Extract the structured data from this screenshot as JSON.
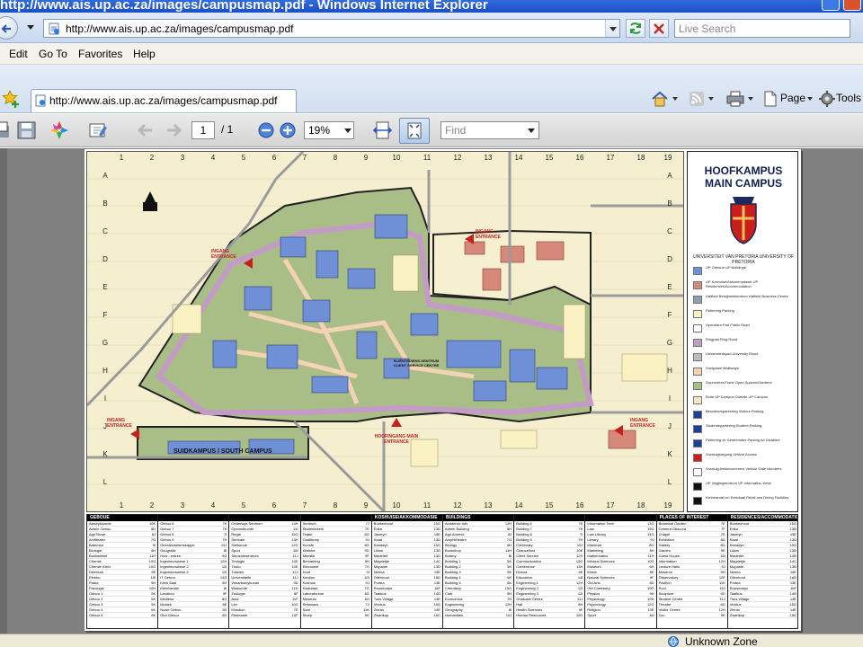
{
  "window": {
    "title": "http://www.ais.up.ac.za/images/campusmap.pdf - Windows Internet Explorer"
  },
  "address": {
    "url": "http://www.ais.up.ac.za/images/campusmap.pdf",
    "search_placeholder": "Live Search"
  },
  "menu": [
    "Edit",
    "Go To",
    "Favorites",
    "Help"
  ],
  "tab": {
    "label": "http://www.ais.up.ac.za/images/campusmap.pdf"
  },
  "command_bar": {
    "page_label": "Page",
    "tools_label": "Tools"
  },
  "pdf_toolbar": {
    "page_current": "1",
    "page_sep": "/ 1",
    "zoom": "19%",
    "find_placeholder": "Find"
  },
  "map": {
    "grid_columns": [
      "1",
      "2",
      "3",
      "4",
      "5",
      "6",
      "7",
      "8",
      "9",
      "10",
      "11",
      "12",
      "13",
      "14",
      "15",
      "16",
      "17",
      "18",
      "19"
    ],
    "grid_rows": [
      "A",
      "B",
      "C",
      "D",
      "E",
      "F",
      "G",
      "H",
      "I",
      "J",
      "K",
      "L"
    ],
    "labels": {
      "south_campus": "SUIDKAMPUS / SOUTH CAMPUS",
      "entrance_west": "INGANG ENTRANCE",
      "entrance_north": "INGANG ENTRANCE",
      "entrance_sw": "INGANG ENTRANCE",
      "entrance_east": "INGANG ENTRANCE",
      "main_entrance": "HOOFINGANG MAIN ENTRANCE",
      "client_service": "KLIËNTEDIENS-SENTRUM CLIENT SERVICE CENTRE"
    }
  },
  "legend": {
    "title_af": "HOOFKAMPUS",
    "title_en": "MAIN CAMPUS",
    "university": "UNIVERSITEIT VAN PRETORIA UNIVERSITY OF PRETORIA",
    "items": [
      {
        "label": "UP Geboue UP Buildings",
        "color": "#6f8fd6"
      },
      {
        "label": "UP Koshuise/Akkommodasie UP Residences/Accommodation",
        "color": "#d6897a"
      },
      {
        "label": "Hatfield Besigheidsentrum Hatfield Business Centre",
        "color": "#8ea0b0"
      },
      {
        "label": "Parkering Parking",
        "color": "#fbf2c4"
      },
      {
        "label": "Openbare Pad Public Road",
        "color": "#ffffff"
      },
      {
        "label": "Ringpad Ring Road",
        "color": "#c49ac7"
      },
      {
        "label": "Universiteitspad University Road",
        "color": "#bdbdbd"
      },
      {
        "label": "Voetpaaie Walkways",
        "color": "#f4d3b5"
      },
      {
        "label": "Oopruimtes/Tuine Open Spaces/Gardens",
        "color": "#a9bd87"
      },
      {
        "label": "Buite UP Kampus Outside UP Campus",
        "color": "#f3ecc4"
      },
      {
        "label": "Besoekersparkering Visitors Parking",
        "color": "#1d3f9a"
      },
      {
        "label": "Studenteparkering Student Parking",
        "color": "#1d3f9a"
      },
      {
        "label": "Parkering vir Gestremdes Parking for Disabled",
        "color": "#1d3f9a"
      },
      {
        "label": "Voertuigtoegang Vehicle Access",
        "color": "#cc1d1d"
      },
      {
        "label": "Voertuig-hekkenommers Vehicle Gate Numbers",
        "color": "#ffffff"
      },
      {
        "label": "UP Inligtingsentrum UP Information Desk",
        "color": "#111111"
      },
      {
        "label": "Kleinhandel en Eetlokaal Retail and Dining Facilities",
        "color": "#111111"
      }
    ]
  },
  "index": {
    "columns": [
      {
        "head": "GEBOUE",
        "rows": [
          [
            "Aardrykkunde",
            "10K"
          ],
          [
            "Admin Gebou",
            "8H"
          ],
          [
            "Agri Nuwe",
            "8J"
          ],
          [
            "Amfiteater",
            "7G"
          ],
          [
            "Bateman",
            "9I"
          ],
          [
            "Biologie",
            "6H"
          ],
          [
            "Boekwinkel",
            "11H"
          ],
          [
            "Chemie",
            "10G"
          ],
          [
            "Chemie Klein",
            "10G"
          ],
          [
            "Dieretuin",
            "9E"
          ],
          [
            "Elektro",
            "10I"
          ],
          [
            "Fisika",
            "9H"
          ],
          [
            "Fisiologie",
            "10H"
          ],
          [
            "Gebou 1",
            "5K"
          ],
          [
            "Gebou 2",
            "5K"
          ],
          [
            "Gebou 3",
            "5K"
          ],
          [
            "Gebou 4",
            "6K"
          ],
          [
            "Gebou 5",
            "6K"
          ]
        ]
      },
      {
        "head": "",
        "rows": [
          [
            "Gebou 6",
            "7K"
          ],
          [
            "Gebou 7",
            "7K"
          ],
          [
            "Gebou 8",
            "7I"
          ],
          [
            "Gebou 9",
            "7H"
          ],
          [
            "Geesteswetenskappe",
            "10J"
          ],
          [
            "Geografie",
            "8I"
          ],
          [
            "Huis - entree",
            "9G"
          ],
          [
            "Ingenieurswese 1",
            "12H"
          ],
          [
            "Ingenieurswese 2",
            "12I"
          ],
          [
            "Ingenieurswese 3",
            "12I"
          ],
          [
            "IT Gebou",
            "13G"
          ],
          [
            "Klein Saal",
            "8H"
          ],
          [
            "Kleinhandel",
            "6I"
          ],
          [
            "Landbou",
            "9F"
          ],
          [
            "Mediese",
            "8G"
          ],
          [
            "Musiek",
            "6E"
          ],
          [
            "Nuwe Gebou",
            "9D"
          ],
          [
            "Oud Gebou",
            "8D"
          ]
        ]
      },
      {
        "head": "",
        "rows": [
          [
            "Onderwys Sentrum",
            "14H"
          ],
          [
            "Opvoedkunde",
            "14I"
          ],
          [
            "Regte",
            "15G"
          ],
          [
            "Sentrale",
            "13H"
          ],
          [
            "Sielkunde",
            "12G"
          ],
          [
            "Sport",
            "16I"
          ],
          [
            "Studentesentrum",
            "11J"
          ],
          [
            "Teologie",
            "10E"
          ],
          [
            "Thuto",
            "10E"
          ],
          [
            "Tukkies",
            "12J"
          ],
          [
            "Universiteits",
            "11J"
          ],
          [
            "Veeartsenykunde",
            "9D"
          ],
          [
            "Wiskunde",
            "11H"
          ],
          [
            "Zoologie",
            "8F"
          ],
          [
            "Aula",
            "11F"
          ],
          [
            "Lier",
            "10G"
          ],
          [
            "Musaion",
            "7E"
          ],
          [
            "Pleknaam",
            "10F"
          ]
        ]
      },
      {
        "head": "",
        "rows": [
          [
            "Sentrum",
            "7J"
          ],
          [
            "Studentekerk",
            "7E"
          ],
          [
            "Teater",
            "6G"
          ],
          [
            "Oudlibrary",
            "9J"
          ],
          [
            "Kunste",
            "8G"
          ],
          [
            "Klinieke",
            "9G"
          ],
          [
            "Menslik",
            "9F"
          ],
          [
            "Bemarking",
            "8H"
          ],
          [
            "Ekonomie",
            "7H"
          ],
          [
            "Hoof",
            "9I"
          ],
          [
            "Kantoor",
            "10I"
          ],
          [
            "Koshuis",
            "9J"
          ],
          [
            "Kwadrant",
            "7G"
          ],
          [
            "Laboratorium",
            "8G"
          ],
          [
            "Museum",
            "6H"
          ],
          [
            "Rekenaar",
            "7J"
          ],
          [
            "Saal",
            "11K"
          ],
          [
            "Stoep",
            "9K"
          ]
        ]
      },
      {
        "head": "KOSHUISE/AKKOMMODASIE",
        "rows": [
          [
            "Boekenhout",
            "15G"
          ],
          [
            "Erika",
            "13D"
          ],
          [
            "Jasmyn",
            "15E"
          ],
          [
            "Kiaat",
            "13D"
          ],
          [
            "Klaradyn",
            "15G"
          ],
          [
            "Lilium",
            "13D"
          ],
          [
            "Madelief",
            "14D"
          ],
          [
            "Magrietjie",
            "14C"
          ],
          [
            "Mopanie",
            "13D"
          ],
          [
            "Nerina",
            "15E"
          ],
          [
            "Olienhout",
            "16D"
          ],
          [
            "Protea",
            "13E"
          ],
          [
            "Roosmaryn",
            "16F"
          ],
          [
            "Taaibos",
            "14D"
          ],
          [
            "Tuks Village",
            "14E"
          ],
          [
            "Vividus",
            "15G"
          ],
          [
            "Zinnia",
            "14E"
          ],
          [
            "Zwartkop",
            "15C"
          ]
        ]
      },
      {
        "head": "BUILDINGS",
        "rows": [
          [
            "Academic Info",
            "12H"
          ],
          [
            "Admin Building",
            "8H"
          ],
          [
            "Agri Annexe",
            "8J"
          ],
          [
            "Amphitheatre",
            "7G"
          ],
          [
            "Biology",
            "6H"
          ],
          [
            "Bookshop",
            "11H"
          ],
          [
            "Botany",
            "8I"
          ],
          [
            "Building 1",
            "5K"
          ],
          [
            "Building 2",
            "5K"
          ],
          [
            "Building 3",
            "5K"
          ],
          [
            "Building 4",
            "6K"
          ],
          [
            "Building 5",
            "6K"
          ],
          [
            "Chemistry",
            "10G"
          ],
          [
            "Club",
            "9H"
          ],
          [
            "Economics",
            "7H"
          ],
          [
            "Engineering",
            "12H"
          ],
          [
            "Geography",
            "8I"
          ],
          [
            "Humanities",
            "10J"
          ]
        ]
      },
      {
        "head": "",
        "rows": [
          [
            "Building 6",
            "7K"
          ],
          [
            "Building 7",
            "7K"
          ],
          [
            "Building 8",
            "7I"
          ],
          [
            "Building 9",
            "7H"
          ],
          [
            "Centenary",
            "10J"
          ],
          [
            "Chancellors",
            "10E"
          ],
          [
            "Client Service",
            "12H"
          ],
          [
            "Communication",
            "13G"
          ],
          [
            "Conference",
            "13H"
          ],
          [
            "Drama",
            "6E"
          ],
          [
            "Education",
            "14I"
          ],
          [
            "Engineering 1",
            "12H"
          ],
          [
            "Engineering 2",
            "12I"
          ],
          [
            "Engineering 3",
            "12I"
          ],
          [
            "Graduate Centre",
            "11J"
          ],
          [
            "Hall",
            "8H"
          ],
          [
            "Health Sciences",
            "9F"
          ],
          [
            "Human Resources",
            "10G"
          ]
        ]
      },
      {
        "head": "",
        "rows": [
          [
            "Information Tech",
            "13G"
          ],
          [
            "Law",
            "15G"
          ],
          [
            "Law Library",
            "14G"
          ],
          [
            "Library",
            "9J"
          ],
          [
            "Mammal",
            "8G"
          ],
          [
            "Marketing",
            "8H"
          ],
          [
            "Mathematics",
            "11H"
          ],
          [
            "Mineral Sciences",
            "10G"
          ],
          [
            "Museum",
            "6H"
          ],
          [
            "Music",
            "6E"
          ],
          [
            "Natural Sciences",
            "9F"
          ],
          [
            "Old Arts",
            "8D"
          ],
          [
            "Old Chemistry",
            "10G"
          ],
          [
            "Physics",
            "9H"
          ],
          [
            "Physiology",
            "10H"
          ],
          [
            "Psychology",
            "12G"
          ],
          [
            "Religion",
            "10E"
          ],
          [
            "Sport",
            "16I"
          ]
        ]
      },
      {
        "head": "PLACES OF INTEREST",
        "rows": [
          [
            "Botanical Garden",
            "7E"
          ],
          [
            "Camera Obscura",
            "7F"
          ],
          [
            "Chapel",
            "7E"
          ],
          [
            "Exhibition",
            "8G"
          ],
          [
            "Gallery",
            "8G"
          ],
          [
            "Garden",
            "9E"
          ],
          [
            "Guest House",
            "16I"
          ],
          [
            "Information",
            "12H"
          ],
          [
            "Lecture Halls",
            "9J"
          ],
          [
            "Museum",
            "6H"
          ],
          [
            "Observatory",
            "10F"
          ],
          [
            "Pavilion",
            "11K"
          ],
          [
            "Pool",
            "16J"
          ],
          [
            "Sculpture",
            "9G"
          ],
          [
            "Student Centre",
            "11J"
          ],
          [
            "Theatre",
            "6G"
          ],
          [
            "Visitor Centre",
            "12H"
          ],
          [
            "Zoo",
            "9E"
          ]
        ]
      },
      {
        "head": "RESIDENCES/ACCOMMODATION",
        "rows": [
          [
            "Boekenhout",
            "15G"
          ],
          [
            "Erika",
            "13D"
          ],
          [
            "Jasmyn",
            "15E"
          ],
          [
            "Kiaat",
            "13D"
          ],
          [
            "Klaradyn",
            "15G"
          ],
          [
            "Lilium",
            "13D"
          ],
          [
            "Madelief",
            "14D"
          ],
          [
            "Magrietjie",
            "14C"
          ],
          [
            "Mopanie",
            "13D"
          ],
          [
            "Nerina",
            "15E"
          ],
          [
            "Olienhout",
            "16D"
          ],
          [
            "Protea",
            "13E"
          ],
          [
            "Roosmaryn",
            "16F"
          ],
          [
            "Taaibos",
            "14D"
          ],
          [
            "Tuks Village",
            "14E"
          ],
          [
            "Vividus",
            "15G"
          ],
          [
            "Zinnia",
            "14E"
          ],
          [
            "Zwartkop",
            "15C"
          ]
        ]
      }
    ]
  },
  "status": {
    "zone": "Unknown Zone"
  },
  "colors": {
    "ring_road": "#c49ac7",
    "buildings": "#6f8fd6",
    "garden": "#a9bd87",
    "parking": "#fbf2c4",
    "entrance": "#cc1d1d"
  }
}
